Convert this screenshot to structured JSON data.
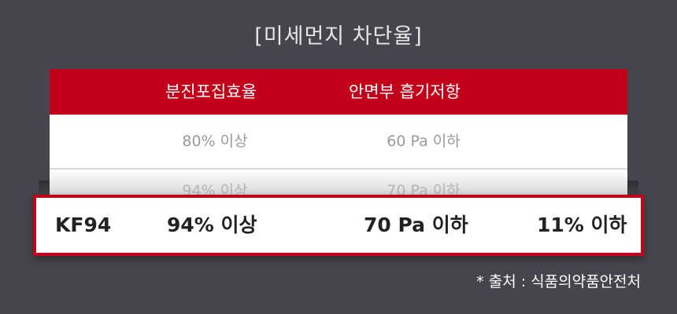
{
  "title": "[미세먼지 차단율]",
  "table": {
    "headers": [
      "분진포집효율",
      "안면부 흡기저항"
    ],
    "row1": [
      "80% 이상",
      "60 Pa 이하"
    ],
    "ghost_row": [
      "94% 이상",
      "70 Pa 이하"
    ]
  },
  "highlight_row": {
    "grade": "KF94",
    "efficiency": "94% 이상",
    "resistance": "70 Pa 이하",
    "leakage": "11% 이하"
  },
  "footnote": "* 출처 : 식품의약품안전처",
  "colors": {
    "accent": "#c2001a",
    "background": "#45454b"
  }
}
